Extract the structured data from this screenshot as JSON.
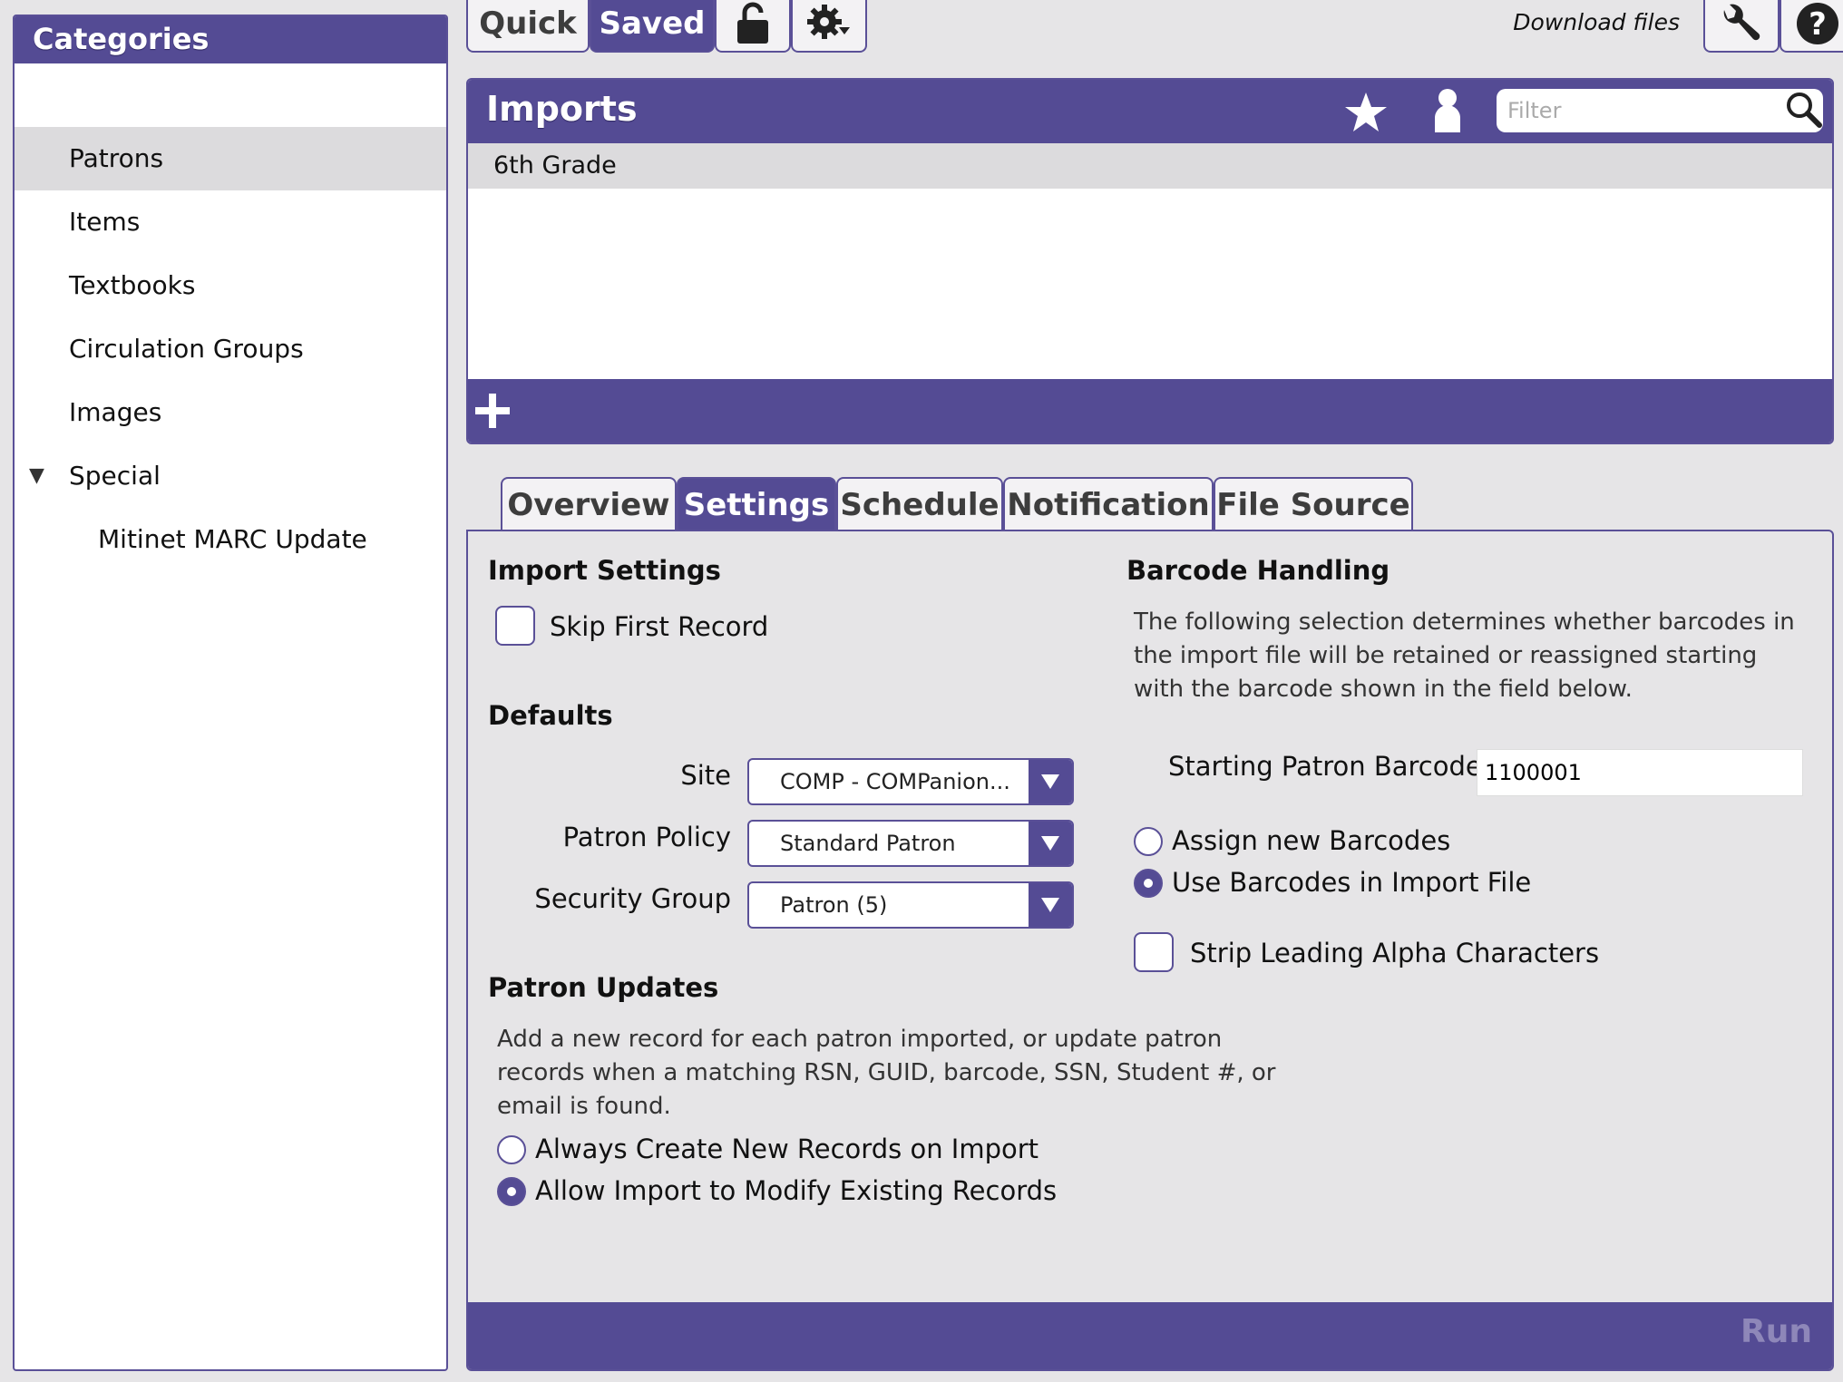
{
  "sidebar": {
    "title": "Categories",
    "items": [
      {
        "label": "Patrons"
      },
      {
        "label": "Items"
      },
      {
        "label": "Textbooks"
      },
      {
        "label": "Circulation Groups"
      },
      {
        "label": "Images"
      },
      {
        "label": "Special"
      },
      {
        "label": "Mitinet MARC Update"
      }
    ],
    "selected": "Patrons"
  },
  "toolbar": {
    "quick_label": "Quick",
    "saved_label": "Saved",
    "lock_icon": "lock-icon",
    "gear_icon": "gear-menu-icon",
    "download_label": "Download files",
    "wrench_icon": "wrench-icon",
    "help_icon": "help-icon"
  },
  "imports": {
    "title": "Imports",
    "filter_placeholder": "Filter",
    "rows": [
      "6th Grade"
    ],
    "add_icon": "plus-icon"
  },
  "tabs": [
    {
      "label": "Overview"
    },
    {
      "label": "Settings",
      "active": true
    },
    {
      "label": "Schedule"
    },
    {
      "label": "Notification"
    },
    {
      "label": "File Source"
    }
  ],
  "settings": {
    "import_settings_title": "Import Settings",
    "skip_first_record": "Skip First Record",
    "defaults_title": "Defaults",
    "site_label": "Site",
    "site_value": "COMP - COMPanion...",
    "policy_label": "Patron Policy",
    "policy_value": "Standard Patron",
    "security_label": "Security Group",
    "security_value": "Patron (5)",
    "updates_title": "Patron Updates",
    "updates_desc": "Add a new record for each patron imported, or update patron records when a matching RSN, GUID, barcode, SSN, Student #, or email is found.",
    "always_create": "Always Create New Records on Import",
    "allow_modify": "Allow Import to Modify Existing Records",
    "barcode_title": "Barcode Handling",
    "barcode_desc": "The following selection determines whether barcodes in the import file will be retained or reassigned starting with the barcode shown in the field below.",
    "starting_label": "Starting Patron Barcode",
    "starting_value": "1100001",
    "assign_new": "Assign new Barcodes",
    "use_import": "Use Barcodes in Import File",
    "strip_alpha": "Strip Leading Alpha Characters",
    "run_label": "Run"
  },
  "colors": {
    "accent": "#544b94",
    "background": "#e6e5e7",
    "selected_row": "#dcdbdd"
  }
}
